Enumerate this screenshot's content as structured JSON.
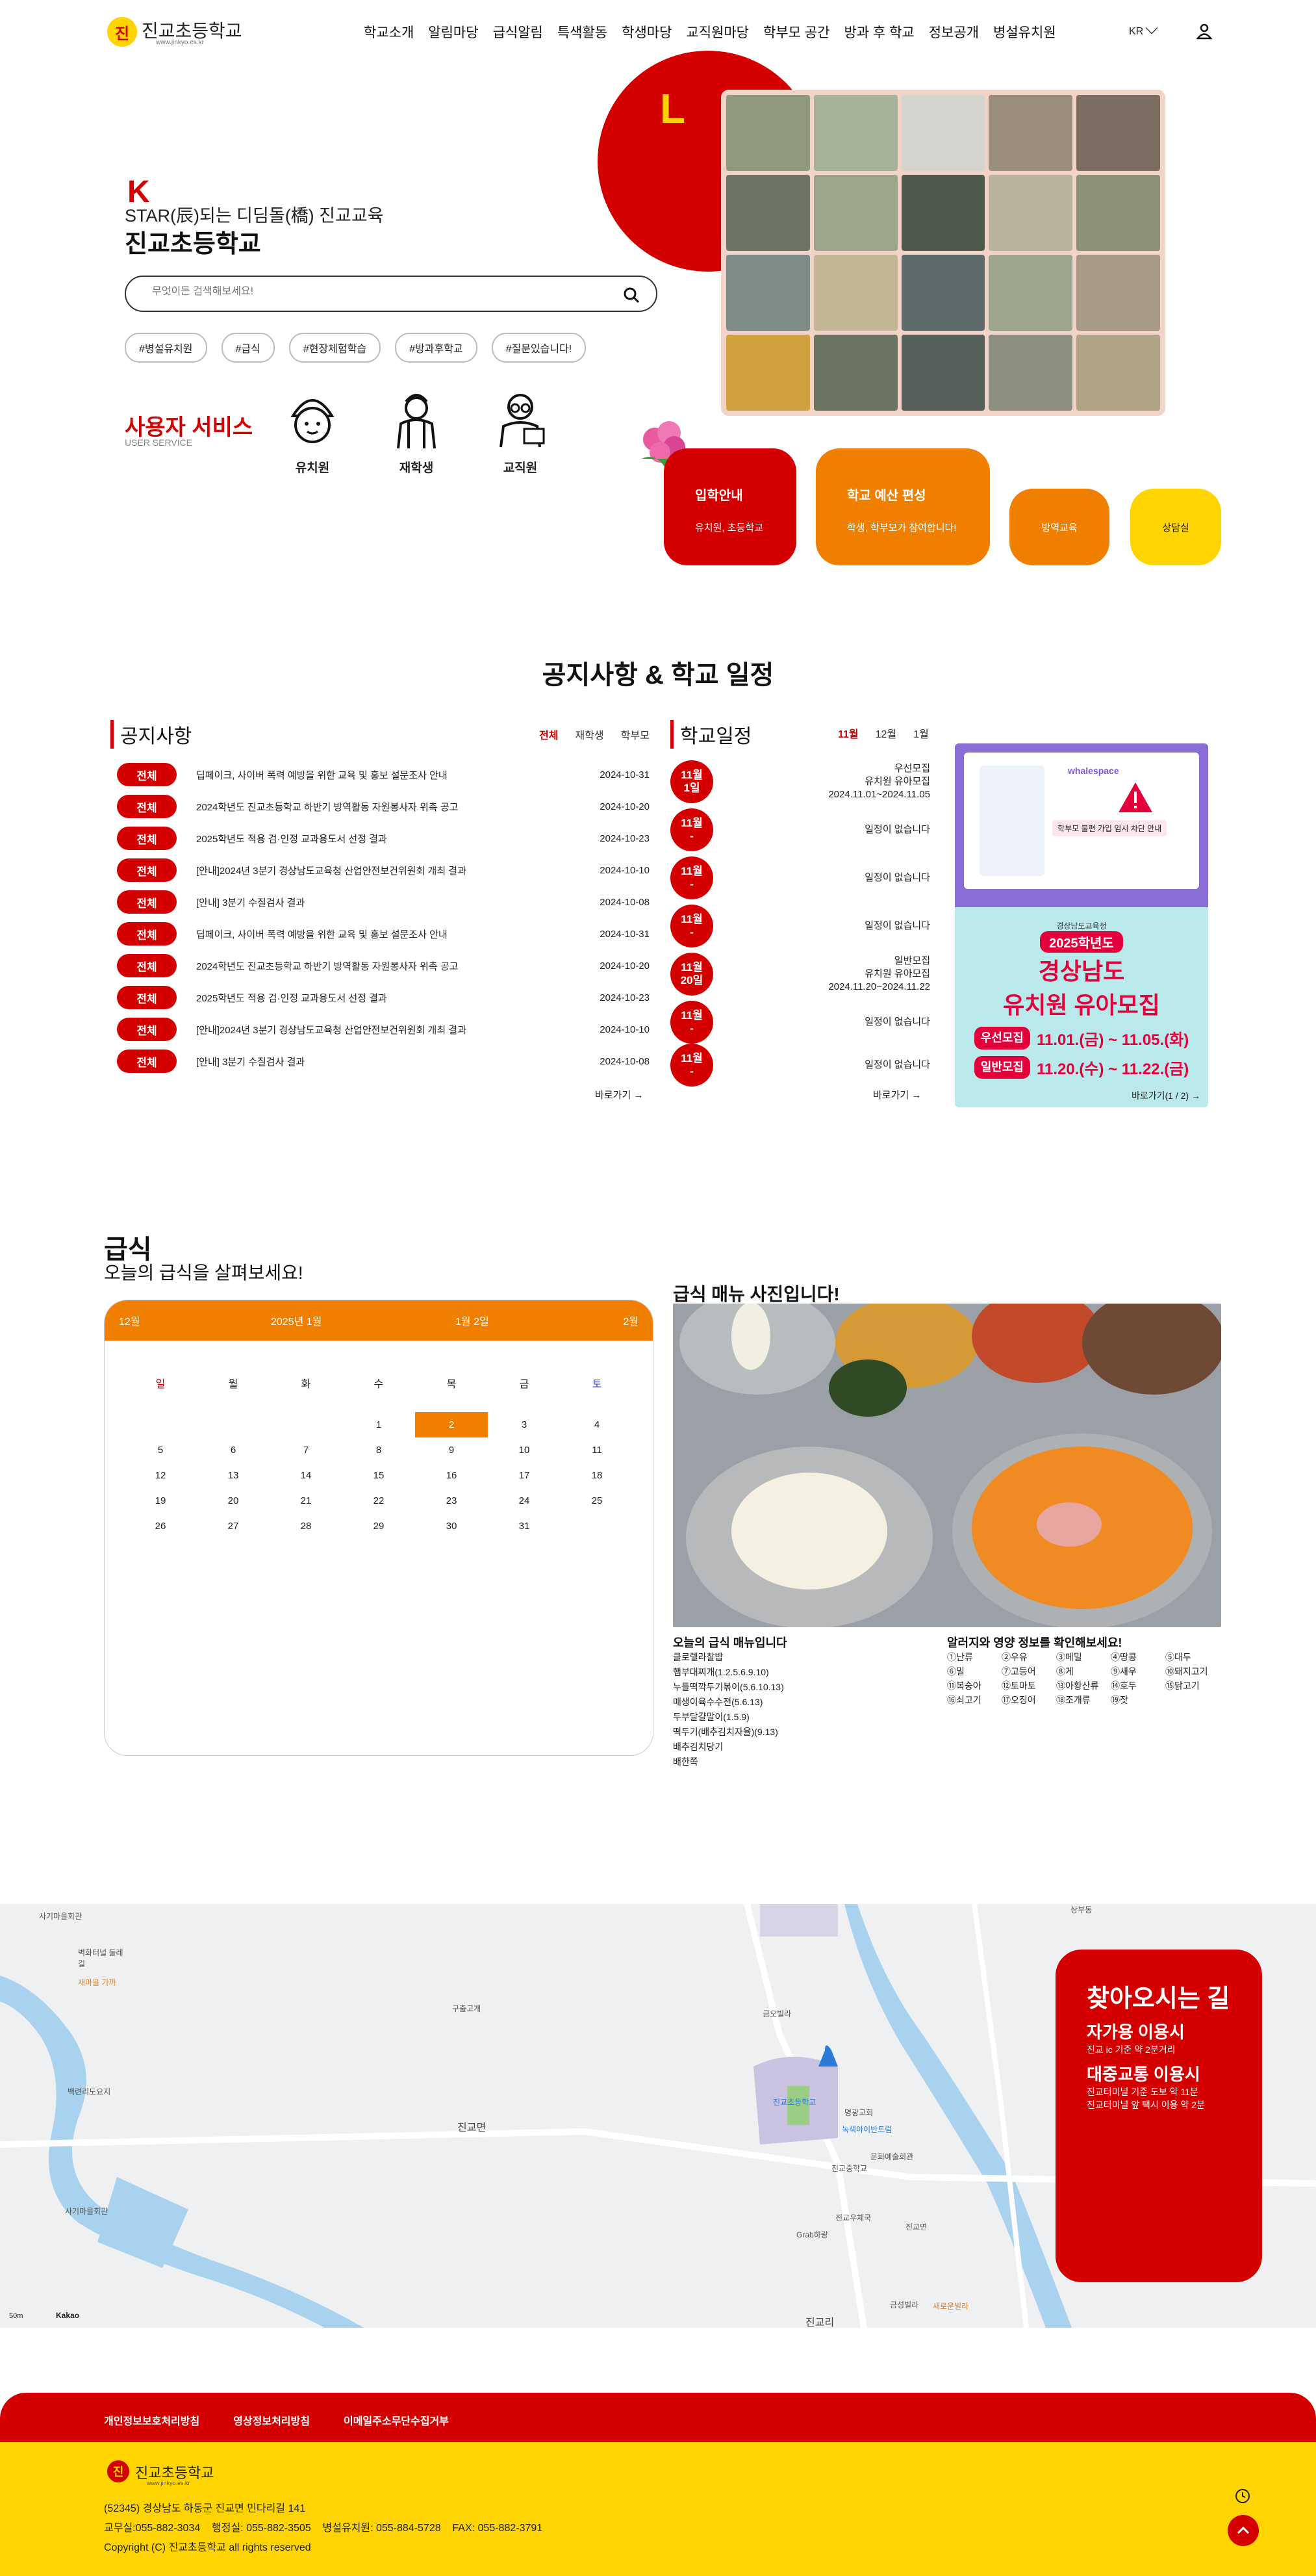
{
  "header": {
    "logo_mark": "진",
    "school_name": "진교초등학교",
    "school_url": "www.jinkyo.es.kr",
    "nav": [
      "학교소개",
      "알림마당",
      "급식알림",
      "특색활동",
      "학생마당",
      "교직원마당",
      "학부모 공간",
      "방과 후 학교",
      "정보공개",
      "병설유치원"
    ],
    "lang": "KR"
  },
  "hero": {
    "deco_letter_left": "K",
    "deco_letter_right": "L",
    "tagline": "STAR(辰)되는 디딤돌(橋) 진교교육",
    "title": "진교초등학교",
    "search_placeholder": "무엇이든 검색해보세요!",
    "tags": [
      "#병설유치원",
      "#급식",
      "#현장체험학습",
      "#방과후학교",
      "#질문있습니다!"
    ]
  },
  "user_service": {
    "title": "사용자 서비스",
    "subtitle": "USER SERVICE",
    "items": [
      "유치원",
      "재학생",
      "교직원"
    ]
  },
  "cards": [
    {
      "title": "입학안내",
      "sub": "유치원, 초등학교",
      "color": "#d40000"
    },
    {
      "title": "학교 예산 편성",
      "sub": "학생, 학부모가 참여합니다!",
      "color": "#f07f00"
    },
    {
      "title": "방역교육",
      "sub": "",
      "color": "#f07f00"
    },
    {
      "title": "상담실",
      "sub": "",
      "color": "#ffd400"
    }
  ],
  "notice_section": {
    "title": "공지사항 & 학교 일정",
    "notice": {
      "heading": "공지사항",
      "filters": [
        "전체",
        "재학생",
        "학부모"
      ],
      "rows": [
        {
          "badge": "전체",
          "title": "딥페이크, 사이버 폭력 예방을 위한 교육 및 홍보 설문조사 안내",
          "date": "2024-10-31"
        },
        {
          "badge": "전체",
          "title": "2024학년도 진교초등학교 하반기 방역활동 자원봉사자 위촉 공고",
          "date": "2024-10-20"
        },
        {
          "badge": "전체",
          "title": "2025학년도 적용 검·인정 교과용도서 선정 결과",
          "date": "2024-10-23"
        },
        {
          "badge": "전체",
          "title": "[안내]2024년 3분기 경상남도교육청 산업안전보건위원회 개최 결과",
          "date": "2024-10-10"
        },
        {
          "badge": "전체",
          "title": "[안내] 3분기 수질검사 결과",
          "date": "2024-10-08"
        },
        {
          "badge": "전체",
          "title": "딥페이크, 사이버 폭력 예방을 위한 교육 및 홍보 설문조사 안내",
          "date": "2024-10-31"
        },
        {
          "badge": "전체",
          "title": "2024학년도 진교초등학교 하반기 방역활동 자원봉사자 위촉 공고",
          "date": "2024-10-20"
        },
        {
          "badge": "전체",
          "title": "2025학년도 적용 검·인정 교과용도서 선정 결과",
          "date": "2024-10-23"
        },
        {
          "badge": "전체",
          "title": "[안내]2024년 3분기 경상남도교육청 산업안전보건위원회 개최 결과",
          "date": "2024-10-10"
        },
        {
          "badge": "전체",
          "title": "[안내] 3분기 수질검사 결과",
          "date": "2024-10-08"
        }
      ],
      "more": "바로가기"
    },
    "schedule": {
      "heading": "학교일정",
      "months": [
        "11월",
        "12월",
        "1월"
      ],
      "rows": [
        {
          "month": "11월",
          "day": "1일",
          "lines": [
            "우선모집",
            "유치원 유아모집",
            "2024.11.01~2024.11.05"
          ]
        },
        {
          "month": "11월",
          "day": "-",
          "lines": [
            "일정이 없습니다"
          ]
        },
        {
          "month": "11월",
          "day": "-",
          "lines": [
            "일정이 없습니다"
          ]
        },
        {
          "month": "11월",
          "day": "-",
          "lines": [
            "일정이 없습니다"
          ]
        },
        {
          "month": "11월",
          "day": "20일",
          "lines": [
            "일반모집",
            "유치원 유아모집",
            "2024.11.20~2024.11.22"
          ]
        },
        {
          "month": "11월",
          "day": "-",
          "lines": [
            "일정이 없습니다"
          ]
        },
        {
          "month": "11월",
          "day": "-",
          "lines": [
            "일정이 없습니다"
          ]
        }
      ],
      "more": "바로가기"
    },
    "banner": {
      "top_title": "학부모 불편 가입 임시 차단 안내",
      "top_brand": "whalespace",
      "bottom_org": "경상남도교육청",
      "bottom_year": "2025학년도",
      "bottom_title": "경상남도",
      "bottom_title2": "유치원 유아모집",
      "first_label": "우선모집",
      "first_dates": "11.01.(금) ~ 11.05.(화)",
      "second_label": "일반모집",
      "second_dates": "11.20.(수) ~ 11.22.(금)",
      "pager": "1 / 2",
      "more": "바로가기"
    }
  },
  "meal": {
    "title": "급식",
    "subtitle": "오늘의 급식을 살펴보세요!",
    "calendar": {
      "prev": "12월",
      "current": "2025년 1월",
      "selected_label": "1월 2일",
      "next": "2월",
      "dow": [
        "일",
        "월",
        "화",
        "수",
        "목",
        "금",
        "토"
      ],
      "weeks": [
        [
          "",
          "",
          "",
          "1",
          "2",
          "3",
          "4"
        ],
        [
          "5",
          "6",
          "7",
          "8",
          "9",
          "10",
          "11"
        ],
        [
          "12",
          "13",
          "14",
          "15",
          "16",
          "17",
          "18"
        ],
        [
          "19",
          "20",
          "21",
          "22",
          "23",
          "24",
          "25"
        ],
        [
          "26",
          "27",
          "28",
          "29",
          "30",
          "31",
          ""
        ]
      ],
      "selected_day": "2"
    },
    "photo_caption": "급식 매뉴 사진입니다!",
    "menu_heading": "오늘의 급식 매뉴입니다",
    "menu": [
      "클로렐라찰밥",
      "햄부대찌개(1.2.5.6.9.10)",
      "누들떡깍두기볶이(5.6.10.13)",
      "매생이육수수전(5.6.13)",
      "두부달걀말이(1.5.9)",
      "떡두기(배추김치자율)(9.13)",
      "배추김치당기",
      "배한쪽"
    ],
    "allergy_heading": "알러지와 영양 정보를 확인해보세요!",
    "allergy": [
      "①난류",
      "②우유",
      "③메밀",
      "④땅콩",
      "⑤대두",
      "⑥밀",
      "⑦고등어",
      "⑧게",
      "⑨새우",
      "⑩돼지고기",
      "⑪복숭아",
      "⑫토마토",
      "⑬아황산류",
      "⑭호두",
      "⑮닭고기",
      "⑯쇠고기",
      "⑰오징어",
      "⑱조개류",
      "⑲잣"
    ]
  },
  "map": {
    "labels": [
      "사기마을회관",
      "벽화터널 둘레길",
      "새마을 가까",
      "구출고개",
      "진교면",
      "백련리도요지",
      "사기마을회관",
      "금오빌라",
      "진교초등학교",
      "명광교회",
      "녹색아이반트럼",
      "진교중학교",
      "문화예술회관",
      "진교우체국",
      "Grab하랑",
      "진교면",
      "진교리",
      "금성빌라",
      "새로운빌라",
      "상부동"
    ],
    "card_title": "찾아오시는 길",
    "car_heading": "자가용 이용시",
    "car_text": "진교 ic 기준 약 2분거리",
    "transit_heading": "대중교통 이용시",
    "transit_text1": "진교터미널 기준 도보 약 11분",
    "transit_text2": "진교터미널 앞 택시 이용 약 2분",
    "scale": "50m",
    "provider": "Kakao"
  },
  "footer": {
    "links": [
      "개인정보보호처리방침",
      "영상정보처리방침",
      "이메일주소무단수집거부"
    ],
    "logo_mark": "진",
    "school_name": "진교초등학교",
    "school_url": "www.jinkyo.es.kr",
    "address": "(52345) 경상남도 하동군 진교면 민다리길 141",
    "phones": "교무실:055-882-3034    행정실: 055-882-3505    병설유치원: 055-884-5728    FAX: 055-882-3791",
    "copyright": "Copyright (C) 진교초등학교 all rights reserved"
  },
  "colors": {
    "brand_red": "#d40000",
    "brand_orange": "#f07f00",
    "brand_yellow": "#ffd400"
  }
}
